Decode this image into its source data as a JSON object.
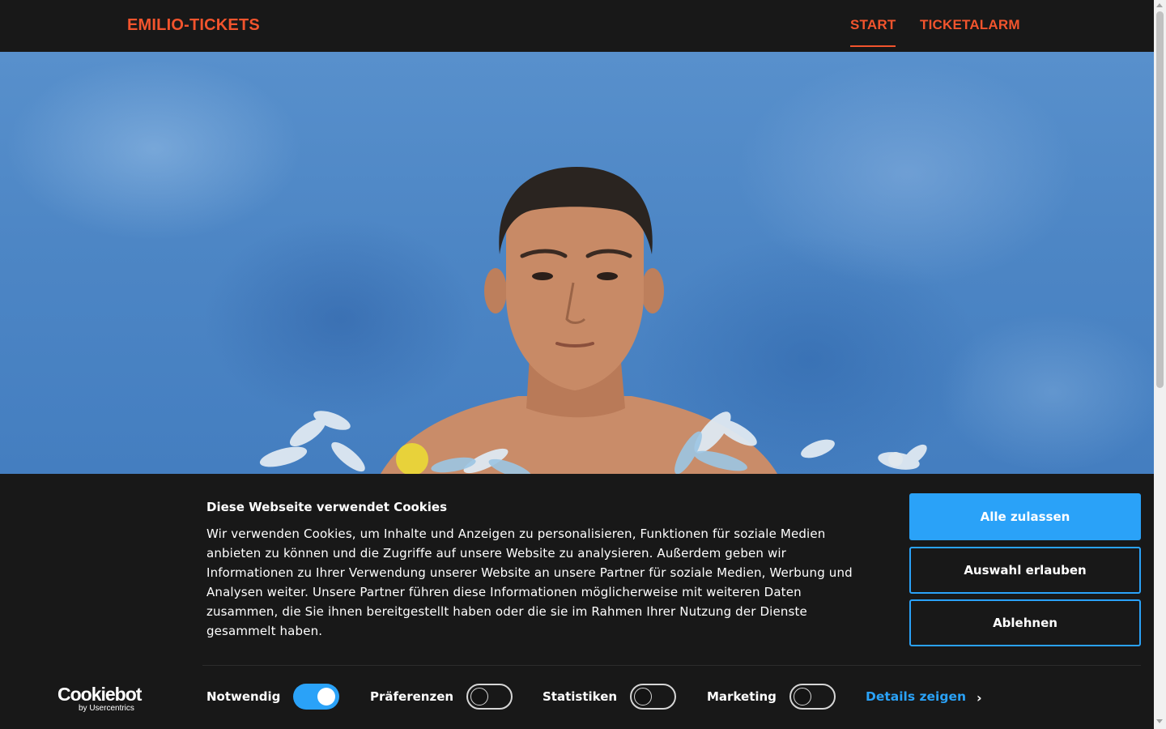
{
  "header": {
    "logo": "EMILIO-TICKETS",
    "nav": [
      {
        "label": "START",
        "active": true
      },
      {
        "label": "TICKETALARM",
        "active": false
      }
    ],
    "accent_color": "#f2542d",
    "background_color": "#181818"
  },
  "hero": {
    "image": "portrait-photo-man-blue-background-flowers"
  },
  "cookie_banner": {
    "title": "Diese Webseite verwendet Cookies",
    "text": "Wir verwenden Cookies, um Inhalte und Anzeigen zu personalisieren, Funktionen für soziale Medien anbieten zu können und die Zugriffe auf unsere Website zu analysieren. Außerdem geben wir Informationen zu Ihrer Verwendung unserer Website an unsere Partner für soziale Medien, Werbung und Analysen weiter. Unsere Partner führen diese Informationen möglicherweise mit weiteren Daten zusammen, die Sie ihnen bereitgestellt haben oder die sie im Rahmen Ihrer Nutzung der Dienste gesammelt haben.",
    "buttons": {
      "allow_all": "Alle zulassen",
      "allow_selection": "Auswahl erlauben",
      "decline": "Ablehnen"
    },
    "logo": {
      "main": "Cookiebot",
      "sub": "by Usercentrics"
    },
    "toggles": [
      {
        "label": "Notwendig",
        "checked": true
      },
      {
        "label": "Präferenzen",
        "checked": false
      },
      {
        "label": "Statistiken",
        "checked": false
      },
      {
        "label": "Marketing",
        "checked": false
      }
    ],
    "details_link": "Details zeigen",
    "accent_color": "#2aa2f8"
  }
}
